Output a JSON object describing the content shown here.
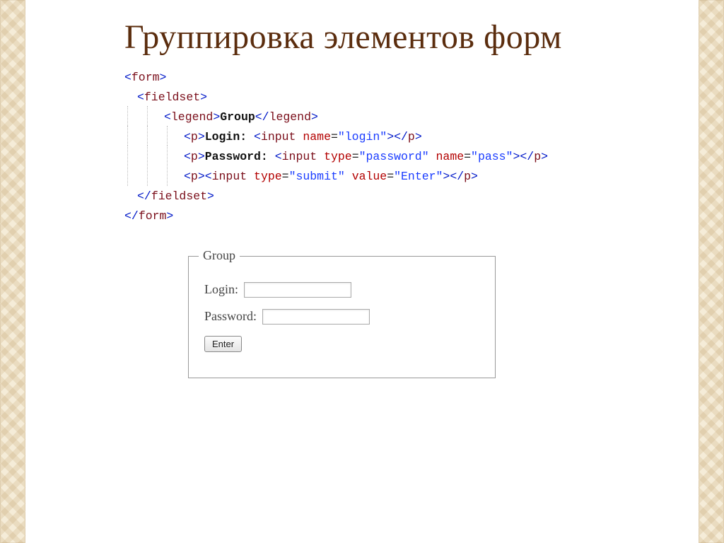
{
  "title": "Группировка элементов форм",
  "code": {
    "tag_form": "form",
    "tag_fieldset": "fieldset",
    "tag_legend": "legend",
    "tag_p": "p",
    "tag_input": "input",
    "text_group": "Group",
    "text_login": "Login: ",
    "text_password": "Password: ",
    "attr_name": "name",
    "attr_type": "type",
    "attr_value": "value",
    "val_login": "\"login\"",
    "val_password": "\"password\"",
    "val_pass": "\"pass\"",
    "val_submit": "\"submit\"",
    "val_enter": "\"Enter\""
  },
  "preview": {
    "legend": "Group",
    "login_label": "Login:",
    "password_label": "Password:",
    "submit_label": "Enter"
  }
}
